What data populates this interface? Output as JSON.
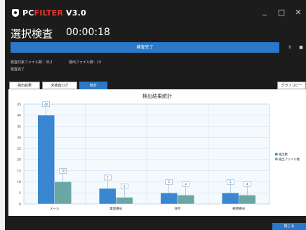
{
  "app": {
    "brand_part1": "PC",
    "brand_part2": "FILTER",
    "version": "V3.0",
    "minimize_glyph": "_",
    "maximize_glyph": "□",
    "close_glyph": "✕"
  },
  "header": {
    "title": "選択検査",
    "timer": "00:00:18"
  },
  "progress": {
    "label": "検査完了",
    "percent": 100,
    "pause_label": "II",
    "stop_label": "■"
  },
  "summary": {
    "target_files": "検査対象ファイル数：312",
    "detected_files": "検出ファイル数：15",
    "status": "検査完了"
  },
  "tabs": [
    {
      "label": "検出結果",
      "active": false
    },
    {
      "label": "未検査ログ",
      "active": false
    },
    {
      "label": "統計",
      "active": true
    }
  ],
  "graph_copy_label": "グラフコピー",
  "close_label": "閉じる",
  "colors": {
    "accent": "#2a78c6",
    "series1": "#3a86d0",
    "series2": "#6aa6a3"
  },
  "chart_data": {
    "type": "bar",
    "title": "検出結果統計",
    "categories": [
      "メール",
      "電話番号",
      "住所",
      "郵便番号"
    ],
    "series": [
      {
        "name": "検出数",
        "values": [
          40,
          7,
          5,
          5
        ]
      },
      {
        "name": "検出ファイル数",
        "values": [
          10,
          3,
          4,
          4
        ]
      }
    ],
    "ylim": [
      0,
      45
    ],
    "yticks": [
      0,
      5,
      10,
      15,
      20,
      25,
      30,
      35,
      40,
      45
    ],
    "grid": true,
    "legend": "right"
  }
}
